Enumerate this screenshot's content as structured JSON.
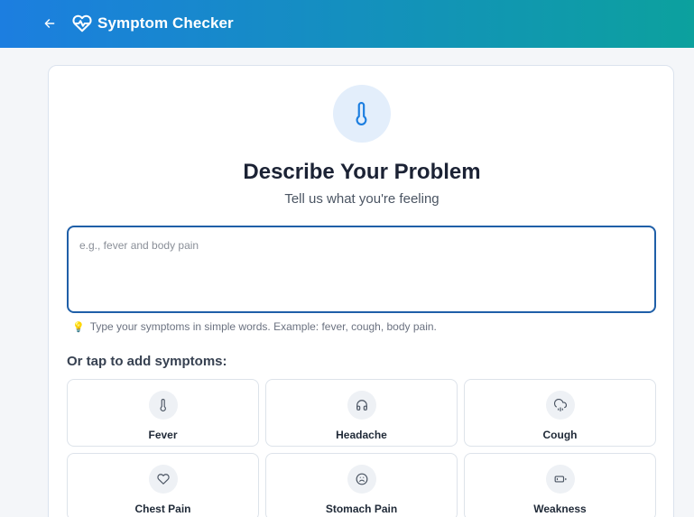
{
  "header": {
    "back_icon": "arrow-left-icon",
    "brand_icon": "heart-pulse-icon",
    "title": "Symptom Checker"
  },
  "card": {
    "hero_icon": "thermometer-icon",
    "title": "Describe Your Problem",
    "subtitle": "Tell us what you're feeling",
    "input": {
      "value": "",
      "placeholder": "e.g., fever and body pain"
    },
    "hint": {
      "icon": "lightbulb-icon",
      "text": "Type your symptoms in simple words. Example: fever, cough, body pain."
    },
    "section_label": "Or tap to add symptoms:",
    "symptoms": [
      {
        "label": "Fever",
        "icon": "thermometer-icon"
      },
      {
        "label": "Headache",
        "icon": "headphones-icon"
      },
      {
        "label": "Cough",
        "icon": "cloud-drizzle-icon"
      },
      {
        "label": "Chest Pain",
        "icon": "heart-icon"
      },
      {
        "label": "Stomach Pain",
        "icon": "frown-icon"
      },
      {
        "label": "Weakness",
        "icon": "battery-low-icon"
      }
    ]
  },
  "colors": {
    "header_gradient_start": "#1c7ee0",
    "header_gradient_end": "#0ca19e",
    "accent": "#1f5fa8"
  }
}
